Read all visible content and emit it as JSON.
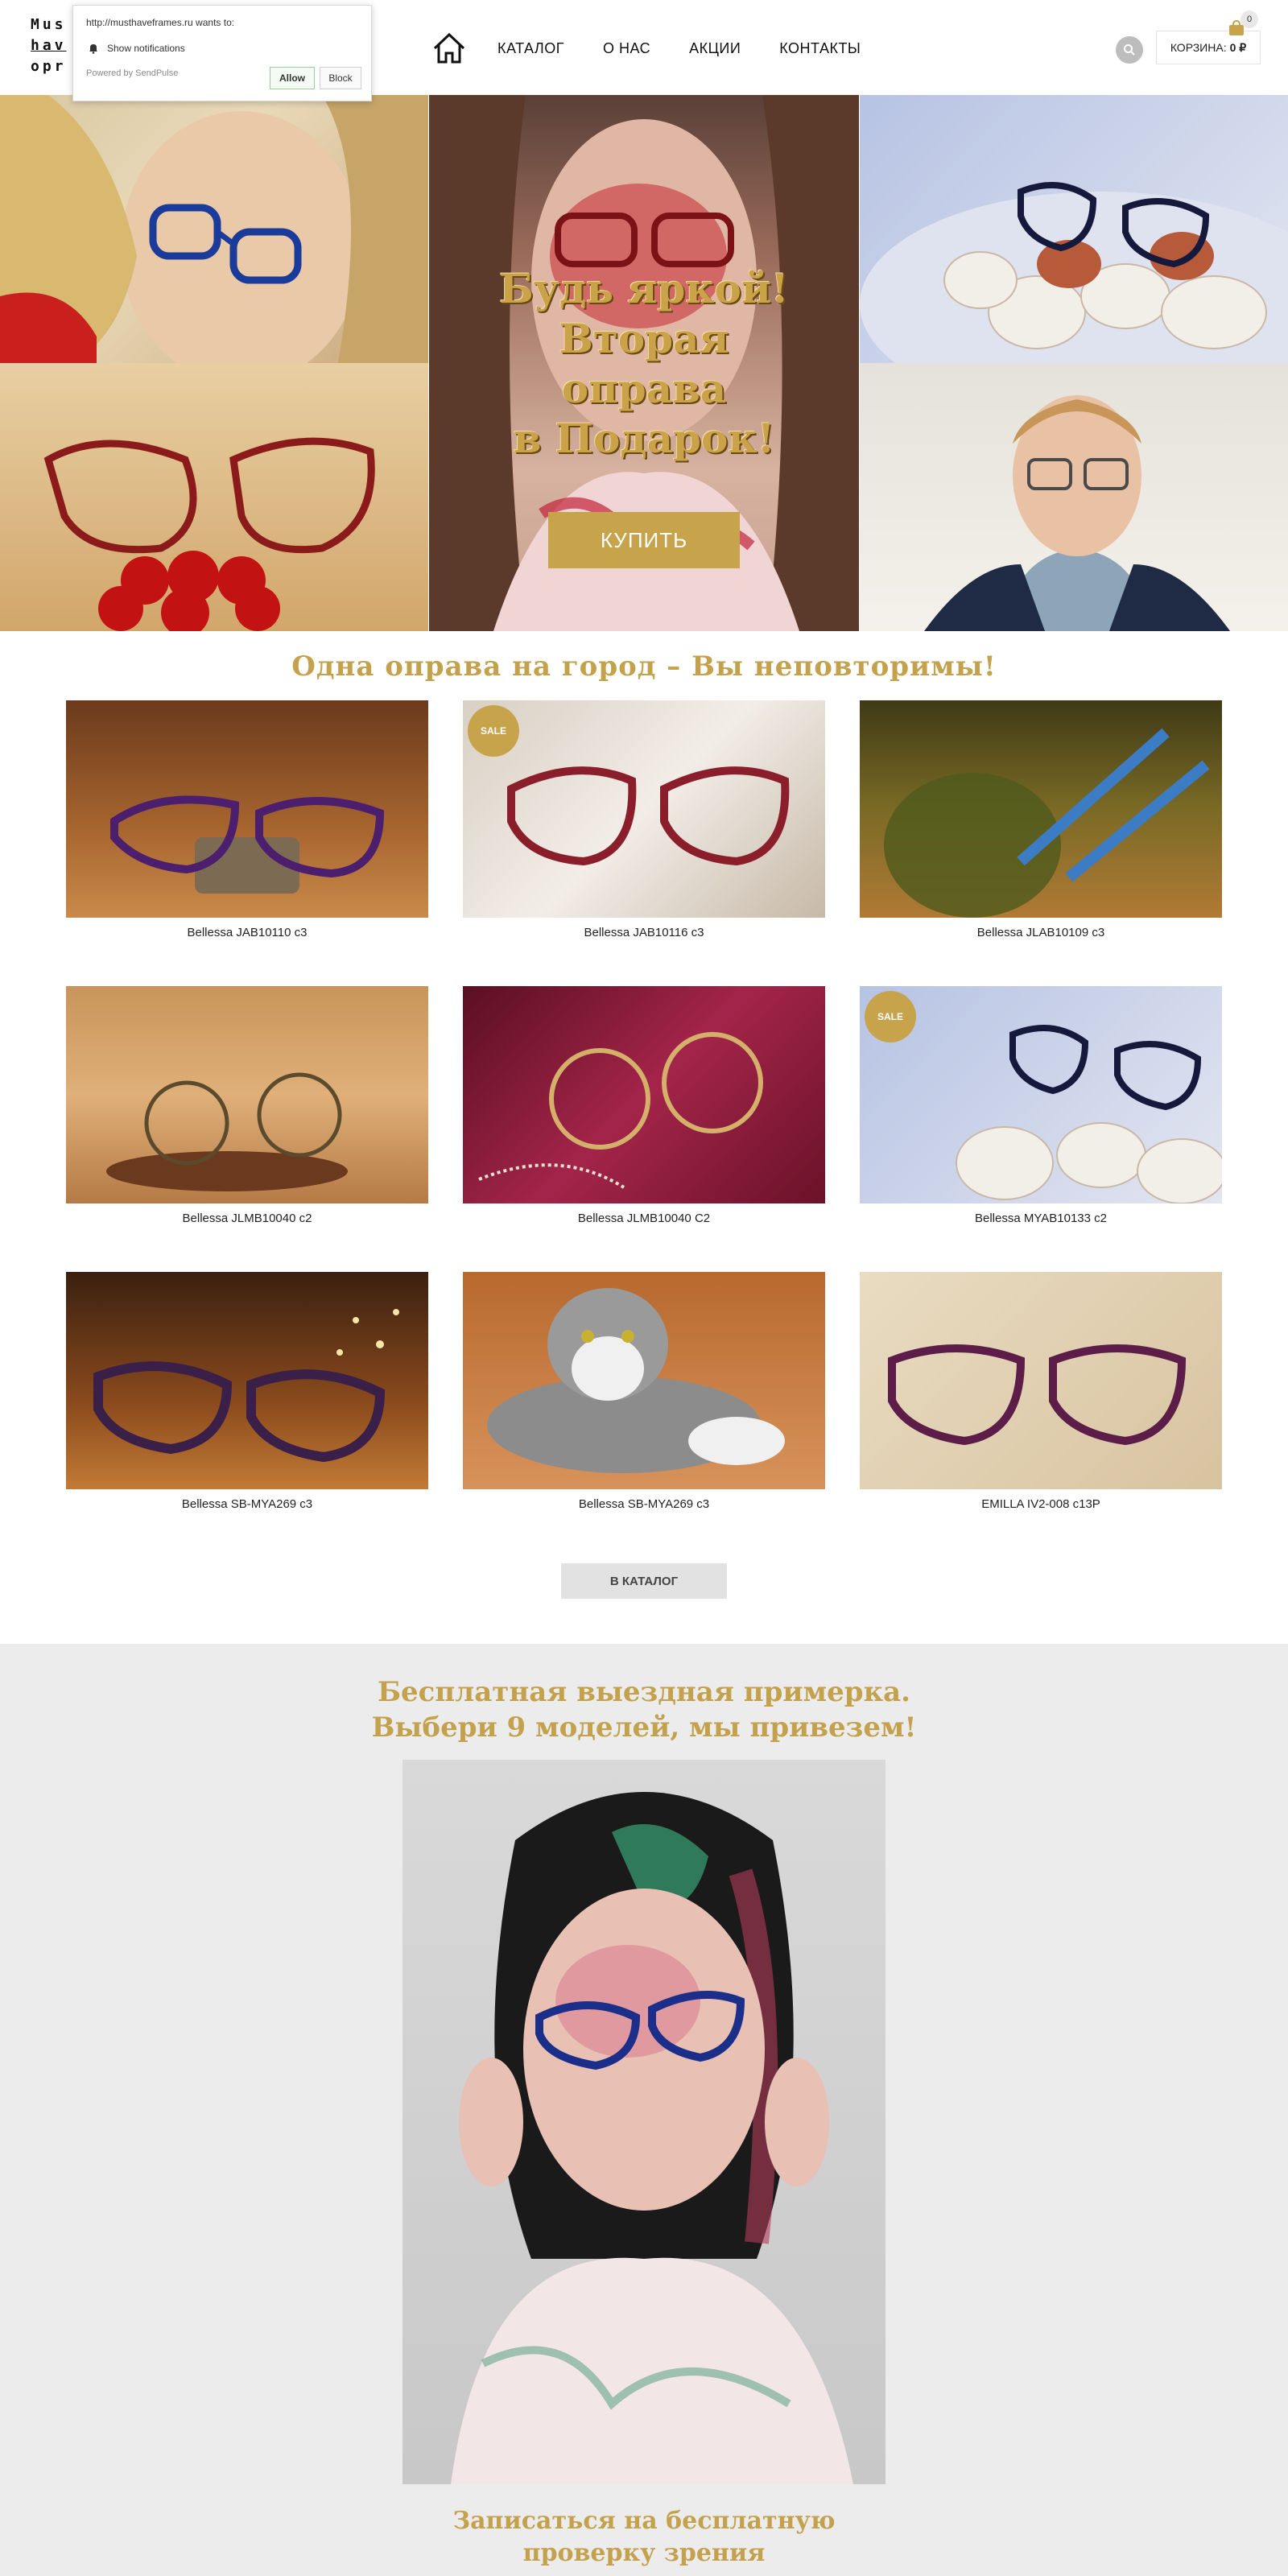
{
  "logo": {
    "line1": "Mus",
    "line2": "hav",
    "line3": "opr"
  },
  "notification": {
    "url_text": "http://musthaveframes.ru wants to:",
    "show_text": "Show notifications",
    "powered_text": "Powered by SendPulse",
    "allow_label": "Allow",
    "block_label": "Block"
  },
  "nav": {
    "items": [
      "КАТАЛОГ",
      "О НАС",
      "АКЦИИ",
      "КОНТАКТЫ"
    ]
  },
  "cart": {
    "label": "КОРЗИНА:",
    "value": "0 ₽",
    "count": "0"
  },
  "hero": {
    "line1": "Будь яркой!",
    "line2": "Вторая",
    "line3": "оправа",
    "line4": "в Подарок!",
    "button_label": "КУПИТЬ"
  },
  "section1_title": "Одна оправа на город – Вы неповторимы!",
  "products": [
    {
      "name": "Bellessa JAB10110 c3",
      "sale": false
    },
    {
      "name": "Bellessa JAB10116 c3",
      "sale": true
    },
    {
      "name": "Bellessa JLAB10109 c3",
      "sale": false
    },
    {
      "name": "Bellessa JLMB10040 c2",
      "sale": false
    },
    {
      "name": "Bellessa JLMB10040 C2",
      "sale": false
    },
    {
      "name": "Bellessa MYAB10133 c2",
      "sale": true
    },
    {
      "name": "Bellessa SB-MYA269 c3",
      "sale": false
    },
    {
      "name": "Bellessa SB-MYA269 c3",
      "sale": false
    },
    {
      "name": "EMILLA IV2-008 c13P",
      "sale": false
    }
  ],
  "sale_label": "SALE",
  "catalog_button": "В КАТАЛОГ",
  "fitting": {
    "title_line1": "Бесплатная выездная примерка.",
    "title_line2": "Выбери 9 моделей, мы привезем!",
    "bottom_line1": "Записаться на бесплатную",
    "bottom_line2": "проверку зрения"
  },
  "colors": {
    "accent": "#c7a34b",
    "section_bg": "#ececec"
  }
}
